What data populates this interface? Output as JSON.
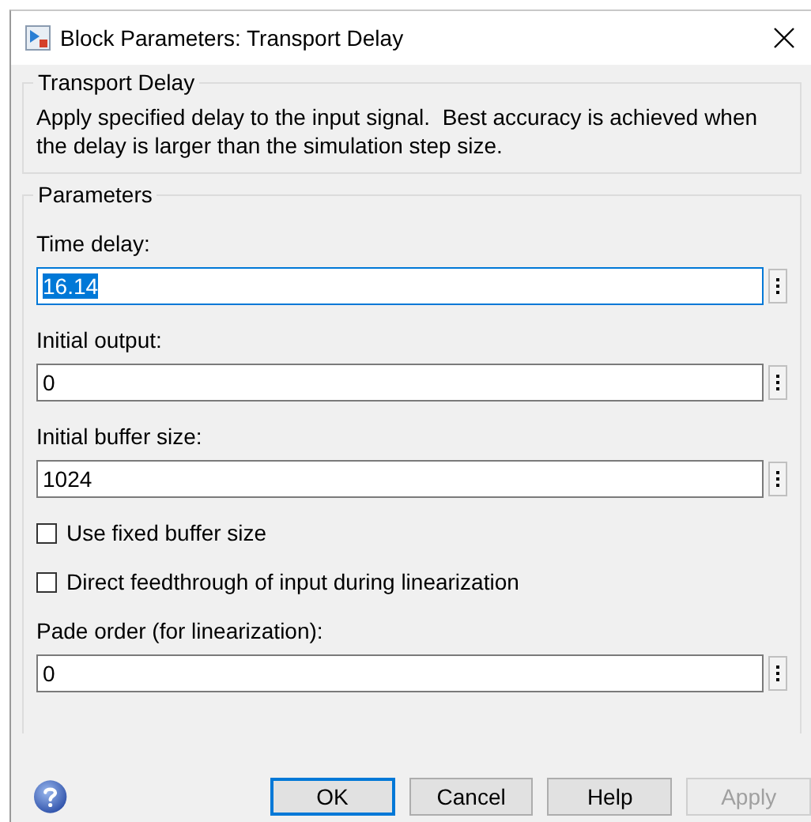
{
  "window": {
    "title": "Block Parameters: Transport Delay"
  },
  "block": {
    "title": "Transport Delay",
    "description": "Apply specified delay to the input signal.  Best accuracy is achieved when the delay is larger than the simulation step size."
  },
  "parameters": {
    "title": "Parameters",
    "items": [
      {
        "kind": "edit",
        "label": "Time delay:",
        "value": "16.14",
        "selected": true
      },
      {
        "kind": "edit",
        "label": "Initial output:",
        "value": "0",
        "selected": false
      },
      {
        "kind": "edit",
        "label": "Initial buffer size:",
        "value": "1024",
        "selected": false
      },
      {
        "kind": "checkbox",
        "label": "Use fixed buffer size",
        "checked": false
      },
      {
        "kind": "checkbox",
        "label": "Direct feedthrough of input during linearization",
        "checked": false
      },
      {
        "kind": "edit",
        "label": "Pade order (for linearization):",
        "value": "0",
        "selected": false
      }
    ]
  },
  "buttons": [
    {
      "label": "OK",
      "default": true,
      "disabled": false
    },
    {
      "label": "Cancel",
      "default": false,
      "disabled": false
    },
    {
      "label": "Help",
      "default": false,
      "disabled": false
    },
    {
      "label": "Apply",
      "default": false,
      "disabled": true
    }
  ]
}
